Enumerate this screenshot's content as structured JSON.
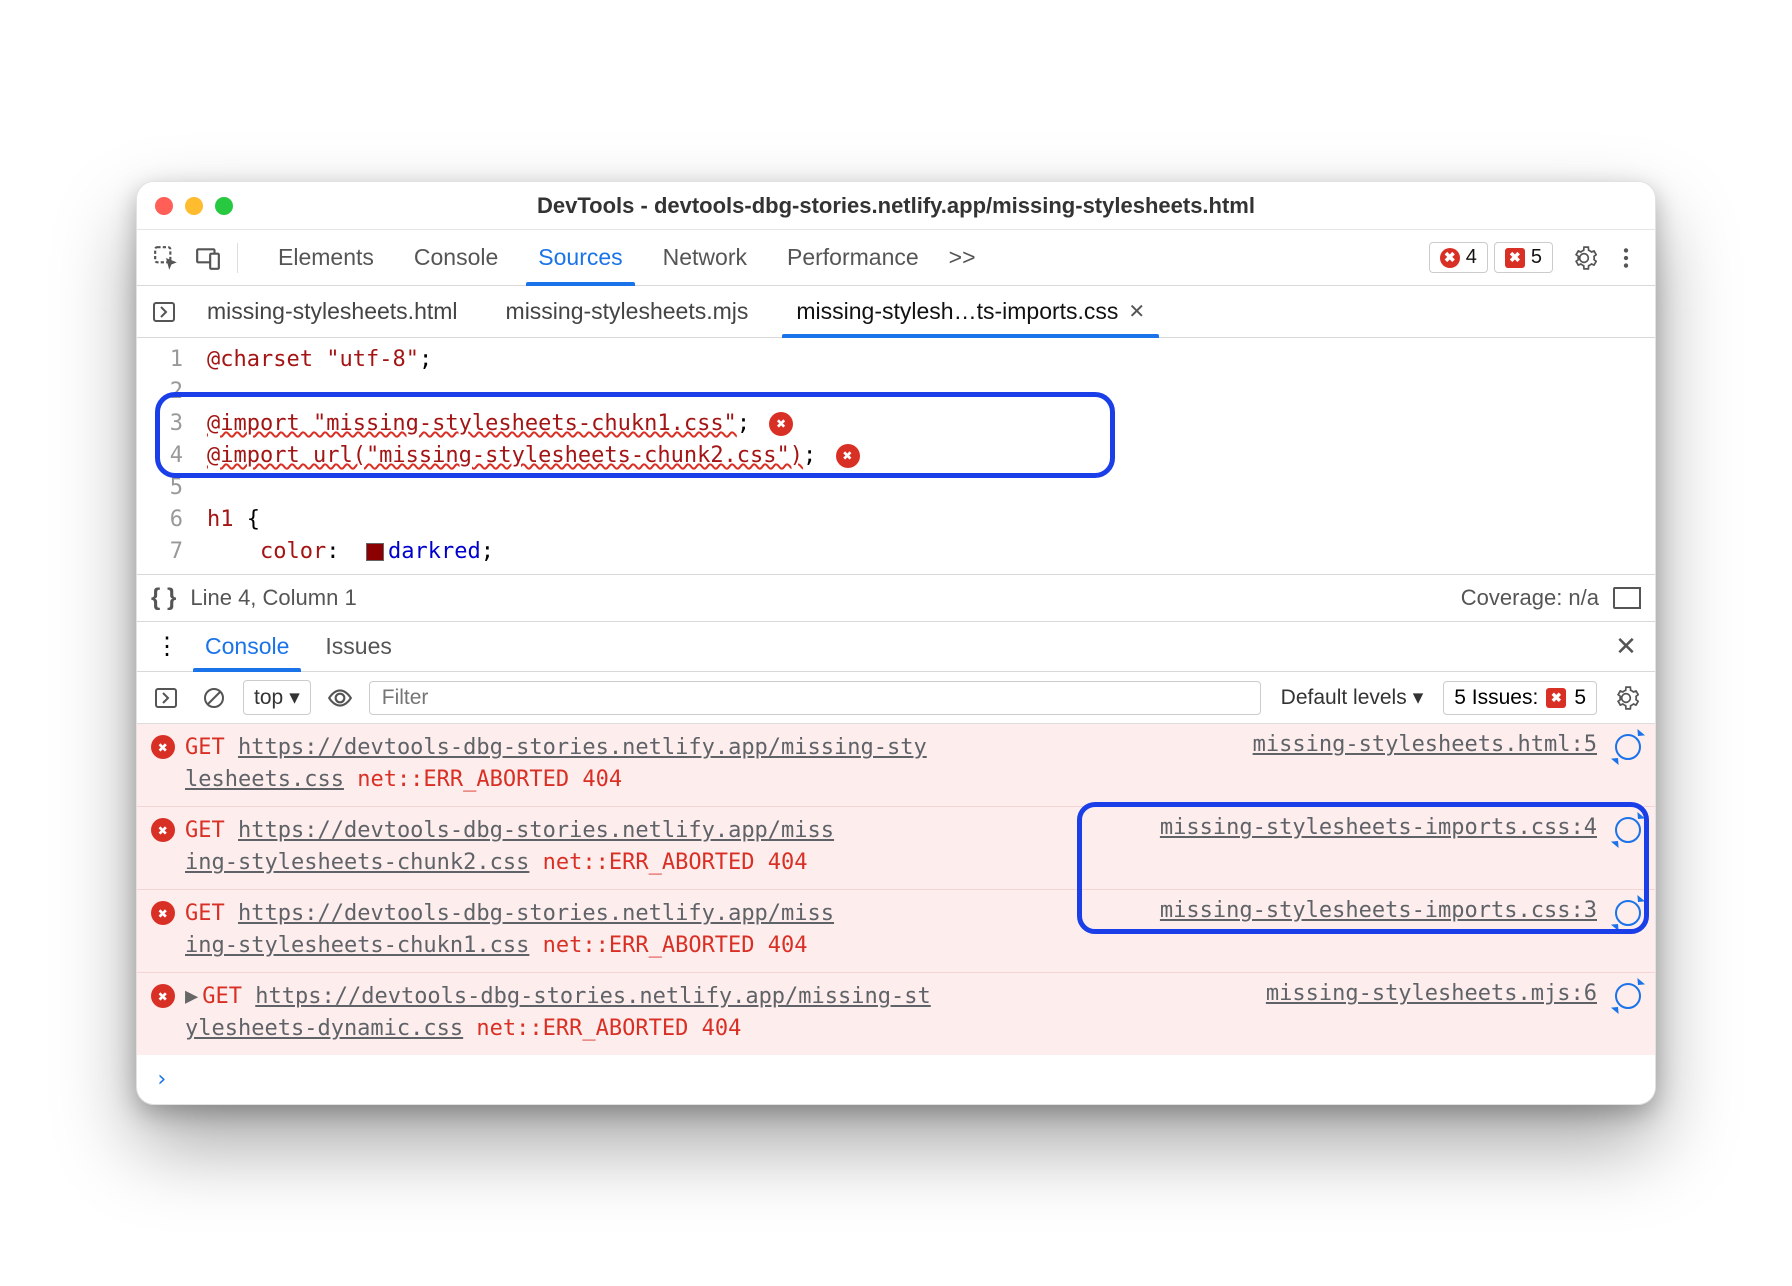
{
  "titlebar": {
    "title": "DevTools - devtools-dbg-stories.netlify.app/missing-stylesheets.html"
  },
  "main_toolbar": {
    "tabs": [
      "Elements",
      "Console",
      "Sources",
      "Network",
      "Performance"
    ],
    "active_tab": "Sources",
    "more": ">>",
    "error_badge_count": "4",
    "issue_badge_count": "5"
  },
  "file_tabs": {
    "items": [
      "missing-stylesheets.html",
      "missing-stylesheets.mjs",
      "missing-stylesh…ts-imports.css"
    ],
    "active_index": 2
  },
  "editor": {
    "lines": [
      "@charset \"utf-8\";",
      "",
      "@import \"missing-stylesheets-chukn1.css\";",
      "@import url(\"missing-stylesheets-chunk2.css\");",
      "",
      "h1 {",
      "    color:  darkred;"
    ]
  },
  "status": {
    "cursor": "Line 4, Column 1",
    "coverage": "Coverage: n/a"
  },
  "drawer_tabs": {
    "items": [
      "Console",
      "Issues"
    ],
    "active_index": 0
  },
  "console_filter": {
    "context": "top",
    "filter_placeholder": "Filter",
    "levels": "Default levels",
    "issues_label": "5 Issues:",
    "issues_count": "5"
  },
  "console_msgs": [
    {
      "method": "GET",
      "url_part1": "https://devtools-dbg-stories.netlify.app/missing-sty",
      "url_part2": "lesheets.css",
      "error": "net::ERR_ABORTED 404",
      "source": "missing-stylesheets.html:5",
      "expandable": false
    },
    {
      "method": "GET",
      "url_part1": "https://devtools-dbg-stories.netlify.app/miss",
      "url_part2": "ing-stylesheets-chunk2.css",
      "error": "net::ERR_ABORTED 404",
      "source": "missing-stylesheets-imports.css:4",
      "expandable": false
    },
    {
      "method": "GET",
      "url_part1": "https://devtools-dbg-stories.netlify.app/miss",
      "url_part2": "ing-stylesheets-chukn1.css",
      "error": "net::ERR_ABORTED 404",
      "source": "missing-stylesheets-imports.css:3",
      "expandable": false
    },
    {
      "method": "GET",
      "url_part1": "https://devtools-dbg-stories.netlify.app/missing-st",
      "url_part2": "ylesheets-dynamic.css",
      "error": "net::ERR_ABORTED 404",
      "source": "missing-stylesheets.mjs:6",
      "expandable": true
    }
  ]
}
